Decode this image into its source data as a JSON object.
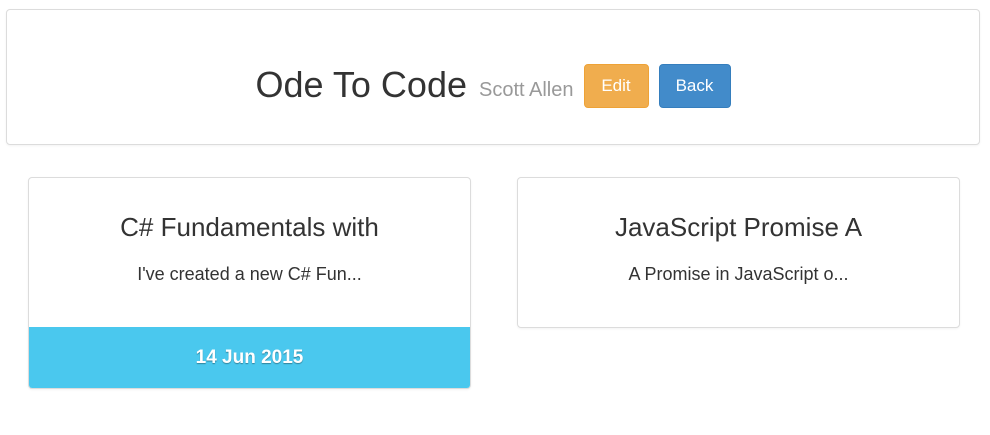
{
  "header": {
    "title": "Ode To Code",
    "author": "Scott Allen",
    "edit_label": "Edit",
    "back_label": "Back"
  },
  "posts": [
    {
      "title": "C# Fundamentals with",
      "excerpt": "I've created a new C# Fun...",
      "date": "14 Jun 2015"
    },
    {
      "title": "JavaScript Promise A",
      "excerpt": "A Promise in JavaScript o..."
    }
  ],
  "colors": {
    "edit_button": "#f0ad4e",
    "back_button": "#428bca",
    "date_footer": "#4ac8ee"
  }
}
